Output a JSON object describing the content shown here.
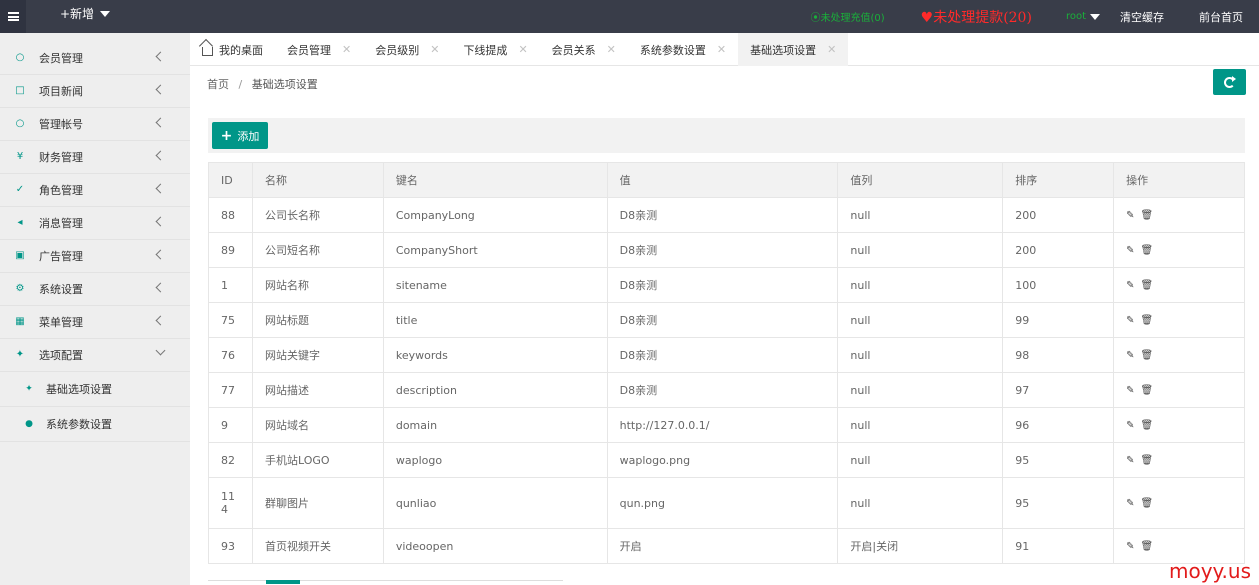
{
  "topbar": {
    "add_new": "+新增",
    "recharge": "⦿未处理充值(0)",
    "withdraw": "♥未处理提款(20)",
    "user": "root",
    "clear_cache": "清空缓存",
    "front_home": "前台首页"
  },
  "sidebar": {
    "items": [
      {
        "label": "会员管理",
        "icon": "user-icon"
      },
      {
        "label": "项目新闻",
        "icon": "news-icon"
      },
      {
        "label": "管理帐号",
        "icon": "admin-icon"
      },
      {
        "label": "财务管理",
        "icon": "yen-icon"
      },
      {
        "label": "角色管理",
        "icon": "shield-icon"
      },
      {
        "label": "消息管理",
        "icon": "speaker-icon"
      },
      {
        "label": "广告管理",
        "icon": "image-icon"
      },
      {
        "label": "系统设置",
        "icon": "gear-icon"
      },
      {
        "label": "菜单管理",
        "icon": "grid-icon"
      },
      {
        "label": "选项配置",
        "icon": "options-icon"
      }
    ],
    "sub_items": [
      {
        "label": "基础选项设置",
        "icon": "options-icon"
      },
      {
        "label": "系统参数设置",
        "icon": "globe-icon"
      }
    ]
  },
  "tabs": [
    {
      "label": "我的桌面"
    },
    {
      "label": "会员管理"
    },
    {
      "label": "会员级别"
    },
    {
      "label": "下线提成"
    },
    {
      "label": "会员关系"
    },
    {
      "label": "系统参数设置"
    },
    {
      "label": "基础选项设置"
    }
  ],
  "breadcrumb": {
    "home": "首页",
    "sep": "/",
    "current": "基础选项设置"
  },
  "toolbar": {
    "add_label": "添加"
  },
  "table": {
    "headers": [
      "ID",
      "名称",
      "键名",
      "值",
      "值列",
      "排序",
      "操作"
    ],
    "rows": [
      {
        "id": "88",
        "name": "公司长名称",
        "key": "CompanyLong",
        "value": "D8亲测",
        "values": "null",
        "sort": "200"
      },
      {
        "id": "89",
        "name": "公司短名称",
        "key": "CompanyShort",
        "value": "D8亲测",
        "values": "null",
        "sort": "200"
      },
      {
        "id": "1",
        "name": "网站名称",
        "key": "sitename",
        "value": "D8亲测",
        "values": "null",
        "sort": "100"
      },
      {
        "id": "75",
        "name": "网站标题",
        "key": "title",
        "value": "D8亲测",
        "values": "null",
        "sort": "99"
      },
      {
        "id": "76",
        "name": "网站关键字",
        "key": "keywords",
        "value": "D8亲测",
        "values": "null",
        "sort": "98"
      },
      {
        "id": "77",
        "name": "网站描述",
        "key": "description",
        "value": "D8亲测",
        "values": "null",
        "sort": "97"
      },
      {
        "id": "9",
        "name": "网站域名",
        "key": "domain",
        "value": "http://127.0.0.1/",
        "values": "null",
        "sort": "96"
      },
      {
        "id": "82",
        "name": "手机站LOGO",
        "key": "waplogo",
        "value": "waplogo.png",
        "values": "null",
        "sort": "95"
      },
      {
        "id": "114",
        "name": "群聊图片",
        "key": "qunliao",
        "value": "qun.png",
        "values": "null",
        "sort": "95"
      },
      {
        "id": "93",
        "name": "首页视频开关",
        "key": "videoopen",
        "value": "开启",
        "values": "开启|关闭",
        "sort": "91"
      }
    ]
  },
  "watermark": "moyy.us",
  "colors": {
    "accent": "#009688",
    "topbar": "#393d49",
    "withdraw": "#ff2a2a",
    "recharge": "#1aaf3a"
  }
}
